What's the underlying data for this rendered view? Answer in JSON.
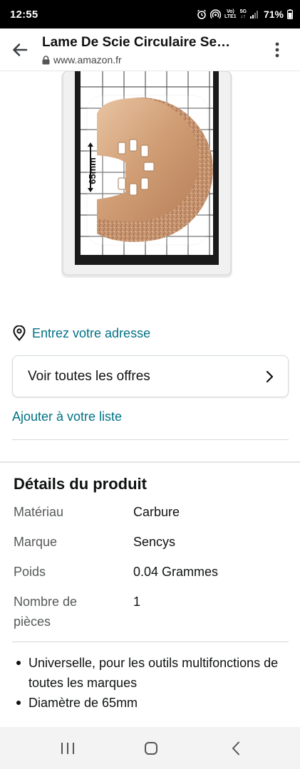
{
  "status_bar": {
    "time": "12:55",
    "network_labels": [
      "Vo)",
      "LTE1",
      "5G"
    ],
    "battery": "71%",
    "icons": [
      "alarm-icon",
      "hotspot-icon",
      "volte-icon",
      "5g-icon",
      "signal-icon",
      "battery-icon"
    ]
  },
  "header": {
    "title": "Lame De Scie Circulaire Se…",
    "url": "www.amazon.fr",
    "back_icon": "back-arrow-icon",
    "lock_icon": "lock-icon",
    "menu_icon": "more-vert-icon"
  },
  "product": {
    "image_label": "65mm"
  },
  "address": {
    "icon": "location-pin-icon",
    "link": "Entrez votre adresse"
  },
  "offers": {
    "label": "Voir toutes les offres",
    "icon": "chevron-right-icon"
  },
  "wishlist": {
    "link": "Ajouter à votre liste"
  },
  "details": {
    "title": "Détails du produit",
    "rows": [
      {
        "key": "Matériau",
        "value": "Carbure"
      },
      {
        "key": "Marque",
        "value": "Sencys"
      },
      {
        "key": "Poids",
        "value": "0.04 Grammes"
      },
      {
        "key": "Nombre de\npièces",
        "value": "1"
      }
    ]
  },
  "bullets": [
    "Universelle, pour les outils multifonctions de toutes les marques",
    "Diamètre de 65mm"
  ],
  "nav": {
    "icons": [
      "recent-apps-icon",
      "home-icon",
      "back-icon"
    ]
  },
  "colors": {
    "link": "#007185",
    "text": "#0f1111",
    "muted": "#565959",
    "border": "#d5d9d9"
  }
}
